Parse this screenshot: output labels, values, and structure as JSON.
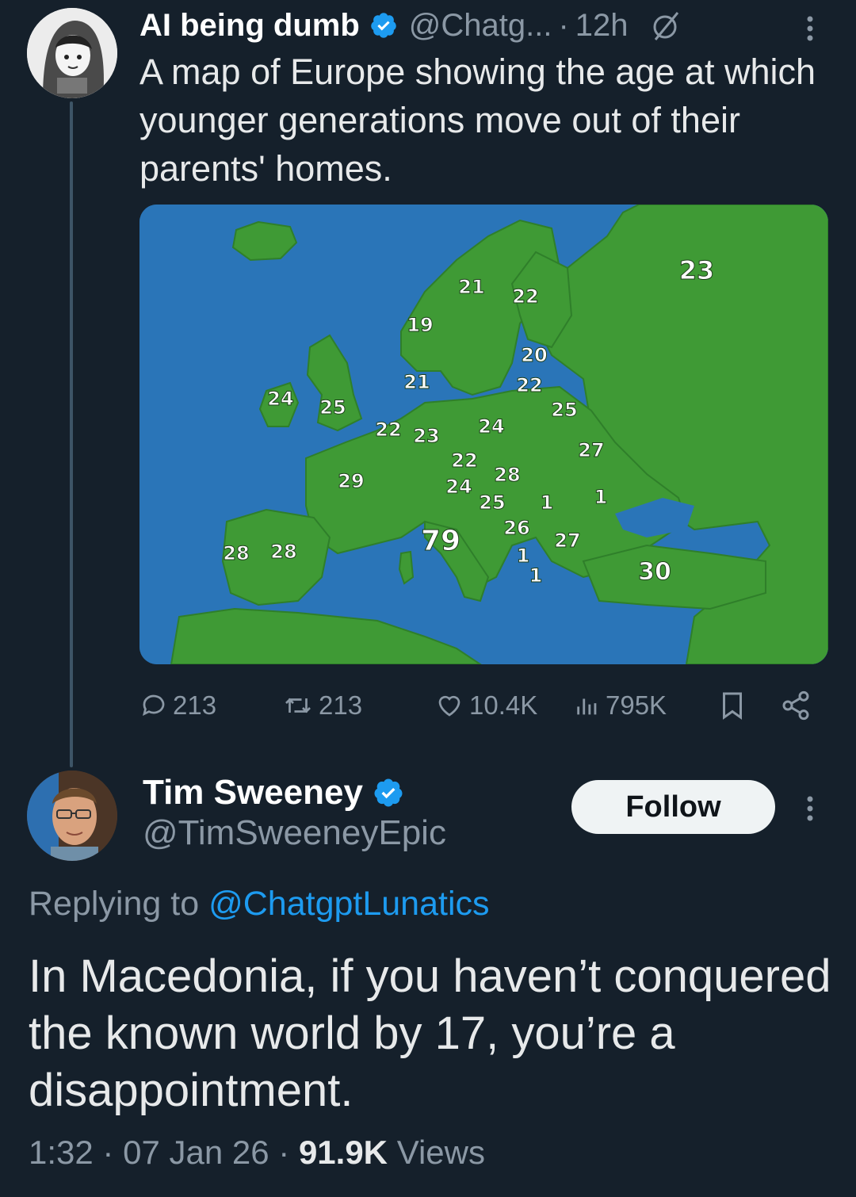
{
  "tweet1": {
    "author_name": "AI being dumb",
    "handle": "@Chatg...",
    "separator": "·",
    "time": "12h",
    "text": "A map of Europe showing the age at which younger generations move out of their parents' homes.",
    "map": {
      "labels": [
        "23",
        "21",
        "22",
        "19",
        "20",
        "21",
        "22",
        "24",
        "25",
        "25",
        "22",
        "23",
        "24",
        "22",
        "27",
        "28",
        "29",
        "24",
        "25",
        "1",
        "1",
        "79",
        "26",
        "28",
        "28",
        "27",
        "1",
        "1",
        "30"
      ]
    },
    "stats": {
      "replies": "213",
      "reposts": "213",
      "likes": "10.4K",
      "views": "795K"
    }
  },
  "tweet2": {
    "author_name": "Tim Sweeney",
    "handle": "@TimSweeneyEpic",
    "follow_label": "Follow",
    "replying_prefix": "Replying to",
    "replying_handle": "@ChatgptLunatics",
    "text": "In Macedonia, if you haven’t conquered the known world by 17, you’re a disappointment.",
    "time": "1:32",
    "date": "07 Jan 26",
    "meta_sep": "·",
    "views_count": "91.9K",
    "views_label": "Views"
  },
  "colors": {
    "background": "#15202b",
    "accent": "#1d9bf0",
    "muted": "#8b98a5",
    "sea": "#2a75b8",
    "land": "#3f9a35"
  }
}
